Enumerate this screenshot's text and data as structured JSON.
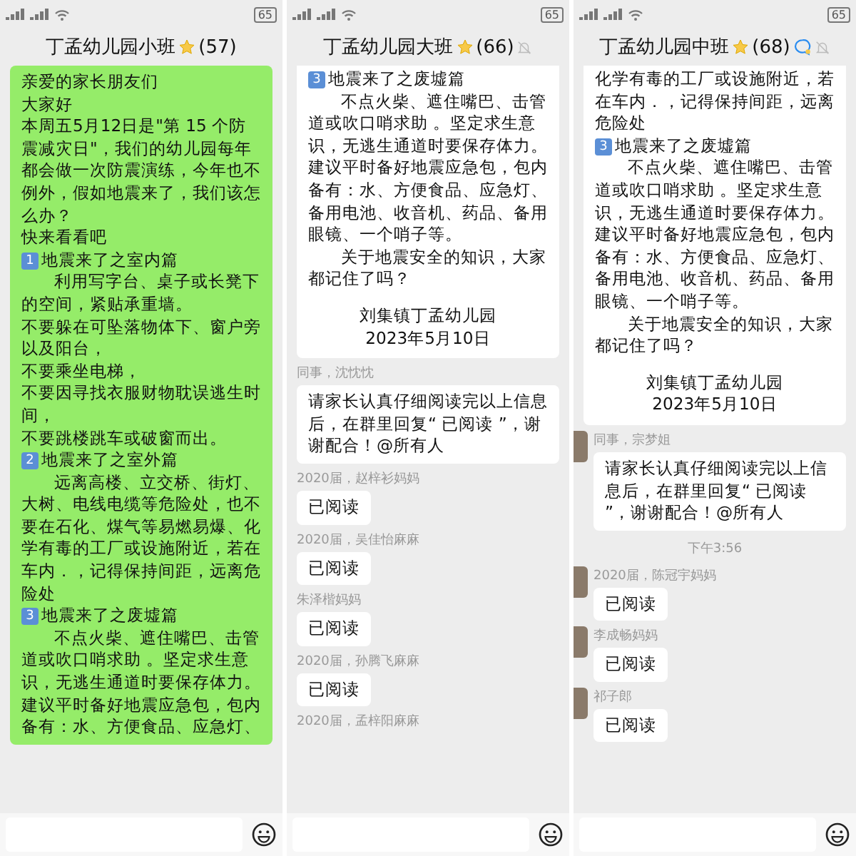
{
  "panels": [
    {
      "status": {
        "battery": "65"
      },
      "header": {
        "title": "丁孟幼儿园小班",
        "count": "(57)",
        "muted": false,
        "bubble_icon": false
      },
      "messages": [
        {
          "kind": "bubble",
          "own": true,
          "cut_top": false,
          "paragraphs": [
            {
              "kind": "text",
              "indent": false,
              "text": "亲爱的家长朋友们"
            },
            {
              "kind": "text",
              "indent": false,
              "text": "大家好"
            },
            {
              "kind": "text",
              "indent": false,
              "text": "本周五5月12日是\"第 15 个防震减灾日\"，我们的幼儿园每年都会做一次防震演练，今年也不例外，假如地震来了，我们该怎么办？"
            },
            {
              "kind": "text",
              "indent": false,
              "text": "快来看看吧"
            },
            {
              "kind": "heading",
              "number": "1",
              "text": "地震来了之室内篇"
            },
            {
              "kind": "text",
              "indent": true,
              "text": "利用写字台、桌子或长凳下的空间，紧贴承重墙。"
            },
            {
              "kind": "text",
              "indent": false,
              "text": "不要躲在可坠落物体下、窗户旁以及阳台，"
            },
            {
              "kind": "text",
              "indent": false,
              "text": "不要乘坐电梯，"
            },
            {
              "kind": "text",
              "indent": false,
              "text": "不要因寻找衣服财物耽误逃生时间，"
            },
            {
              "kind": "text",
              "indent": false,
              "text": "不要跳楼跳车或破窗而出。"
            },
            {
              "kind": "heading",
              "number": "2",
              "text": "地震来了之室外篇"
            },
            {
              "kind": "text",
              "indent": true,
              "text": "远离高楼、立交桥、街灯、大树、电线电缆等危险处，也不要在石化、煤气等易燃易爆、化学有毒的工厂或设施附近，若在车内．，记得保持间距，远离危险处"
            },
            {
              "kind": "heading",
              "number": "3",
              "text": "地震来了之废墟篇"
            },
            {
              "kind": "text",
              "indent": true,
              "text": "不点火柴、遮住嘴巴、击管道或吹口哨求助 。坚定求生意识，无逃生通道时要保存体力。建议平时备好地震应急包，包内备有：水、方便食品、应急灯、"
            }
          ]
        }
      ]
    },
    {
      "status": {
        "battery": "65"
      },
      "header": {
        "title": "丁孟幼儿园大班",
        "count": "(66)",
        "muted": true,
        "bubble_icon": false
      },
      "messages": [
        {
          "kind": "bubble",
          "own": false,
          "cut_top": true,
          "paragraphs": [
            {
              "kind": "heading",
              "number": "3",
              "text": "地震来了之废墟篇"
            },
            {
              "kind": "text",
              "indent": true,
              "text": "不点火柴、遮住嘴巴、击管道或吹口哨求助 。坚定求生意识，无逃生通道时要保存体力。建议平时备好地震应急包，包内备有：水、方便食品、应急灯、备用电池、收音机、药品、备用眼镜、一个哨子等。"
            },
            {
              "kind": "text",
              "indent": true,
              "text": "关于地震安全的知识，大家都记住了吗？"
            },
            {
              "kind": "signature",
              "text": "刘集镇丁孟幼儿园"
            },
            {
              "kind": "date",
              "text": "2023年5月10日"
            }
          ]
        },
        {
          "kind": "bubble",
          "own": false,
          "sender": "同事，沈忱忱",
          "cut_top": false,
          "paragraphs": [
            {
              "kind": "text",
              "indent": false,
              "text": "请家长认真仔细阅读完以上信息后，在群里回复“ 已阅读 ”，谢谢配合！@所有人"
            }
          ]
        },
        {
          "kind": "bubble",
          "own": false,
          "sender": "2020届，赵梓衫妈妈",
          "cut_top": false,
          "paragraphs": [
            {
              "kind": "text",
              "indent": false,
              "text": "已阅读"
            }
          ]
        },
        {
          "kind": "bubble",
          "own": false,
          "sender": "2020届，吴佳怡麻麻",
          "cut_top": false,
          "paragraphs": [
            {
              "kind": "text",
              "indent": false,
              "text": "已阅读"
            }
          ]
        },
        {
          "kind": "bubble",
          "own": false,
          "sender": "朱泽楷妈妈",
          "cut_top": false,
          "paragraphs": [
            {
              "kind": "text",
              "indent": false,
              "text": "已阅读"
            }
          ]
        },
        {
          "kind": "bubble",
          "own": false,
          "sender": "2020届，孙腾飞麻麻",
          "cut_top": false,
          "paragraphs": [
            {
              "kind": "text",
              "indent": false,
              "text": "已阅读"
            }
          ]
        },
        {
          "kind": "sender",
          "text": "2020届，孟梓阳麻麻"
        }
      ]
    },
    {
      "status": {
        "battery": "65"
      },
      "header": {
        "title": "丁孟幼儿园中班",
        "count": "(68)",
        "muted": true,
        "bubble_icon": true
      },
      "messages": [
        {
          "kind": "bubble",
          "own": false,
          "cut_top": true,
          "avatar": false,
          "paragraphs": [
            {
              "kind": "text",
              "indent": false,
              "text": "化学有毒的工厂或设施附近，若在车内．，记得保持间距，远离危险处"
            },
            {
              "kind": "heading",
              "number": "3",
              "text": "地震来了之废墟篇"
            },
            {
              "kind": "text",
              "indent": true,
              "text": "不点火柴、遮住嘴巴、击管道或吹口哨求助 。坚定求生意识，无逃生通道时要保存体力。建议平时备好地震应急包，包内备有：水、方便食品、应急灯、备用电池、收音机、药品、备用眼镜、一个哨子等。"
            },
            {
              "kind": "text",
              "indent": true,
              "text": "关于地震安全的知识，大家都记住了吗？"
            },
            {
              "kind": "signature",
              "text": "刘集镇丁孟幼儿园"
            },
            {
              "kind": "date",
              "text": "2023年5月10日"
            }
          ]
        },
        {
          "kind": "bubble",
          "own": false,
          "sender": "同事，宗梦姐",
          "cut_top": false,
          "avatar": true,
          "paragraphs": [
            {
              "kind": "text",
              "indent": false,
              "text": "请家长认真仔细阅读完以上信息后，在群里回复“ 已阅读 ”，谢谢配合！@所有人"
            }
          ]
        },
        {
          "kind": "time",
          "text": "下午3:56"
        },
        {
          "kind": "bubble",
          "own": false,
          "sender": "2020届，陈冠宇妈妈",
          "cut_top": false,
          "avatar": true,
          "paragraphs": [
            {
              "kind": "text",
              "indent": false,
              "text": "已阅读"
            }
          ]
        },
        {
          "kind": "bubble",
          "own": false,
          "sender": "李成畅妈妈",
          "cut_top": false,
          "avatar": true,
          "paragraphs": [
            {
              "kind": "text",
              "indent": false,
              "text": "已阅读"
            }
          ]
        },
        {
          "kind": "bubble",
          "own": false,
          "sender": "祁子郎",
          "cut_top": false,
          "avatar": true,
          "paragraphs": [
            {
              "kind": "text",
              "indent": false,
              "text": "已阅读"
            }
          ]
        }
      ]
    }
  ]
}
